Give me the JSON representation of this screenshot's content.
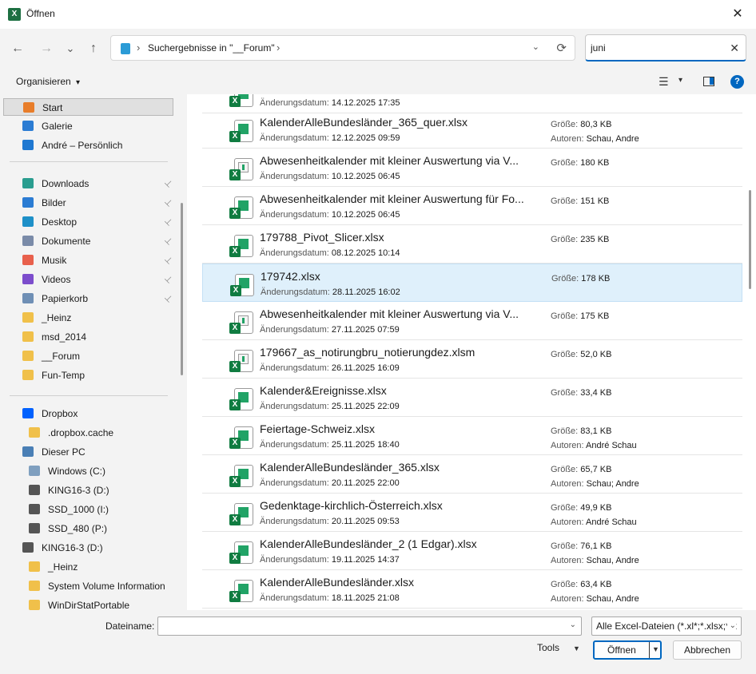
{
  "window": {
    "title": "Öffnen",
    "app_icon_letter": "X",
    "close_glyph": "✕"
  },
  "nav": {
    "back_glyph": "←",
    "forward_glyph": "→",
    "recent_glyph": "⌄",
    "up_glyph": "↑",
    "address_sep1": "›",
    "address_path": "Suchergebnisse in \"__Forum\"",
    "address_sep2": "›",
    "address_dropdown_glyph": "⌄",
    "refresh_glyph": "⟳",
    "search_value": "juni",
    "search_clear_glyph": "✕"
  },
  "toolbar": {
    "organize_label": "Organisieren",
    "organize_caret": "▾",
    "view_glyph": "☰",
    "view_caret": "▾",
    "help_glyph": "?"
  },
  "sidebar": {
    "quick": [
      {
        "label": "Start",
        "icon": "home-icon",
        "color": "#e87d2a"
      },
      {
        "label": "Galerie",
        "icon": "gallery-icon",
        "color": "#2b7cd3"
      },
      {
        "label": "André – Persönlich",
        "icon": "onedrive-icon",
        "color": "#1f78d1"
      }
    ],
    "pinned": [
      {
        "label": "Downloads",
        "icon": "download-icon",
        "color": "#2a9d8f"
      },
      {
        "label": "Bilder",
        "icon": "pictures-icon",
        "color": "#2b7cd3"
      },
      {
        "label": "Desktop",
        "icon": "desktop-icon",
        "color": "#1e90c8"
      },
      {
        "label": "Dokumente",
        "icon": "documents-icon",
        "color": "#7a8ba8"
      },
      {
        "label": "Musik",
        "icon": "music-icon",
        "color": "#e8604c"
      },
      {
        "label": "Videos",
        "icon": "videos-icon",
        "color": "#7c4dcc"
      },
      {
        "label": "Papierkorb",
        "icon": "recycle-bin-icon",
        "color": "#6f8fb5"
      }
    ],
    "folders": [
      {
        "label": "_Heinz",
        "icon": "folder-icon",
        "color": "#f0c04a"
      },
      {
        "label": "msd_2014",
        "icon": "folder-icon",
        "color": "#f0c04a"
      },
      {
        "label": "__Forum",
        "icon": "folder-icon",
        "color": "#f0c04a"
      },
      {
        "label": "Fun-Temp",
        "icon": "folder-icon",
        "color": "#f0c04a"
      }
    ],
    "tree": [
      {
        "label": "Dropbox",
        "icon": "dropbox-icon",
        "color": "#0061fe"
      },
      {
        "label": ".dropbox.cache",
        "icon": "folder-icon",
        "color": "#f0c04a"
      },
      {
        "label": "Dieser PC",
        "icon": "pc-icon",
        "color": "#4a7fb5"
      },
      {
        "label": "Windows (C:)",
        "icon": "drive-icon",
        "color": "#7f9fbf"
      },
      {
        "label": "KING16-3 (D:)",
        "icon": "drive-icon",
        "color": "#555555"
      },
      {
        "label": "SSD_1000 (I:)",
        "icon": "drive-icon",
        "color": "#555555"
      },
      {
        "label": "SSD_480 (P:)",
        "icon": "drive-icon",
        "color": "#555555"
      },
      {
        "label": "KING16-3 (D:)",
        "icon": "drive-icon",
        "color": "#555555"
      },
      {
        "label": "_Heinz",
        "icon": "folder-icon",
        "color": "#f0c04a"
      },
      {
        "label": "System Volume Information",
        "icon": "folder-icon",
        "color": "#f0c04a"
      },
      {
        "label": "WinDirStatPortable",
        "icon": "folder-icon",
        "color": "#f0c04a"
      }
    ],
    "pin_glyph": "📌"
  },
  "files": {
    "date_label": "Änderungsdatum:",
    "size_label": "Größe:",
    "author_label": "Autoren:",
    "partial_first_date": "14.12.2025 17:35",
    "items": [
      {
        "name": "KalenderAlleBundesländer_365_quer.xlsx",
        "date": "12.12.2025 09:59",
        "size": "80,3 KB",
        "authors": "Schau, Andre",
        "type": "xlsx"
      },
      {
        "name": "Abwesenheitkalender mit kleiner Auswertung via V...",
        "date": "10.12.2025 06:45",
        "size": "180 KB",
        "authors": "",
        "type": "xlsm"
      },
      {
        "name": "Abwesenheitkalender mit kleiner Auswertung für Fo...",
        "date": "10.12.2025 06:45",
        "size": "151 KB",
        "authors": "",
        "type": "xlsx"
      },
      {
        "name": "179788_Pivot_Slicer.xlsx",
        "date": "08.12.2025 10:14",
        "size": "235 KB",
        "authors": "",
        "type": "xlsx"
      },
      {
        "name": "179742.xlsx",
        "date": "28.11.2025 16:02",
        "size": "178 KB",
        "authors": "",
        "type": "xlsx"
      },
      {
        "name": "Abwesenheitkalender mit kleiner Auswertung via V...",
        "date": "27.11.2025 07:59",
        "size": "175 KB",
        "authors": "",
        "type": "xlsm"
      },
      {
        "name": "179667_as_notirungbru_notierungdez.xlsm",
        "date": "26.11.2025 16:09",
        "size": "52,0 KB",
        "authors": "",
        "type": "xlsm"
      },
      {
        "name": "Kalender&Ereignisse.xlsx",
        "date": "25.11.2025 22:09",
        "size": "33,4 KB",
        "authors": "",
        "type": "xlsx"
      },
      {
        "name": "Feiertage-Schweiz.xlsx",
        "date": "25.11.2025 18:40",
        "size": "83,1 KB",
        "authors": "André Schau",
        "type": "xlsx"
      },
      {
        "name": "KalenderAlleBundesländer_365.xlsx",
        "date": "20.11.2025 22:00",
        "size": "65,7 KB",
        "authors": "Schau; Andre",
        "type": "xlsx"
      },
      {
        "name": "Gedenktage-kirchlich-Österreich.xlsx",
        "date": "20.11.2025 09:53",
        "size": "49,9 KB",
        "authors": "André Schau",
        "type": "xlsx"
      },
      {
        "name": "KalenderAlleBundesländer_2 (1 Edgar).xlsx",
        "date": "19.11.2025 14:37",
        "size": "76,1 KB",
        "authors": "Schau, Andre",
        "type": "xlsx"
      },
      {
        "name": "KalenderAlleBundesländer.xlsx",
        "date": "18.11.2025 21:08",
        "size": "63,4 KB",
        "authors": "Schau, Andre",
        "type": "xlsx"
      }
    ]
  },
  "footer": {
    "filename_label": "Dateiname:",
    "filename_value": "",
    "filter_value": "Alle Excel-Dateien (*.xl*;*.xlsx;*.x",
    "caret": "⌄",
    "tools_label": "Tools",
    "tools_caret": "▼",
    "open_label": "Öffnen",
    "open_caret": "▼",
    "cancel_label": "Abbrechen"
  },
  "colors": {
    "accent": "#0067c0",
    "excel_green": "#107c41",
    "selection": "#dff0fb"
  }
}
